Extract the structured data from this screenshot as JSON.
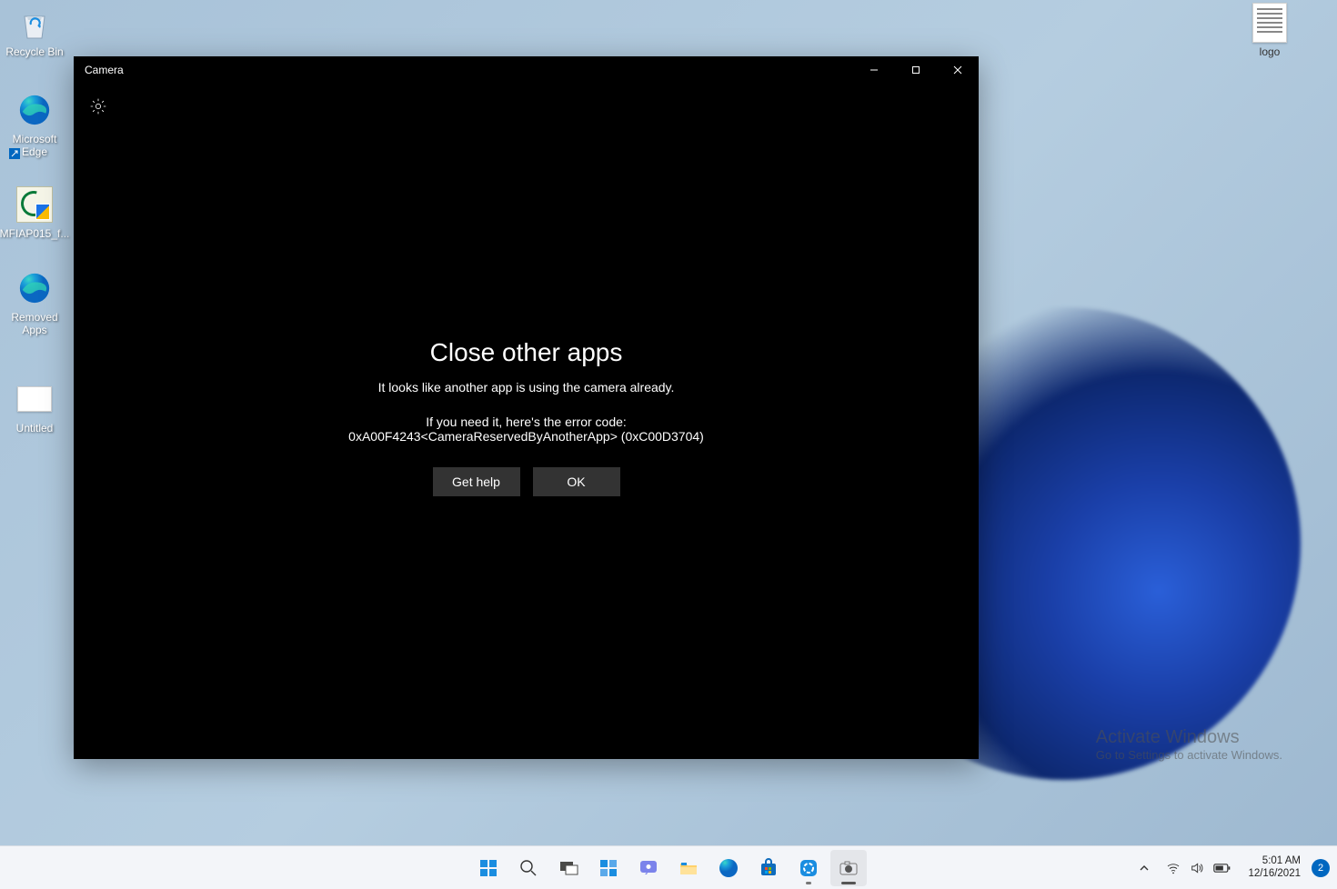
{
  "desktop": {
    "icons": [
      {
        "label": "Recycle Bin"
      },
      {
        "label": "Microsoft Edge"
      },
      {
        "label": "MFIAP015_f..."
      },
      {
        "label": "Removed Apps"
      },
      {
        "label": "Untitled"
      },
      {
        "label": "logo"
      }
    ]
  },
  "camera_window": {
    "title": "Camera",
    "error": {
      "heading": "Close other apps",
      "line1": "It looks like another app is using the camera already.",
      "line2": "If you need it, here's the error code:",
      "line3": "0xA00F4243<CameraReservedByAnotherApp> (0xC00D3704)",
      "get_help_label": "Get help",
      "ok_label": "OK"
    }
  },
  "watermark": {
    "title": "Activate Windows",
    "subtitle": "Go to Settings to activate Windows."
  },
  "taskbar": {
    "clock_time": "5:01 AM",
    "clock_date": "12/16/2021",
    "notification_count": "2"
  }
}
